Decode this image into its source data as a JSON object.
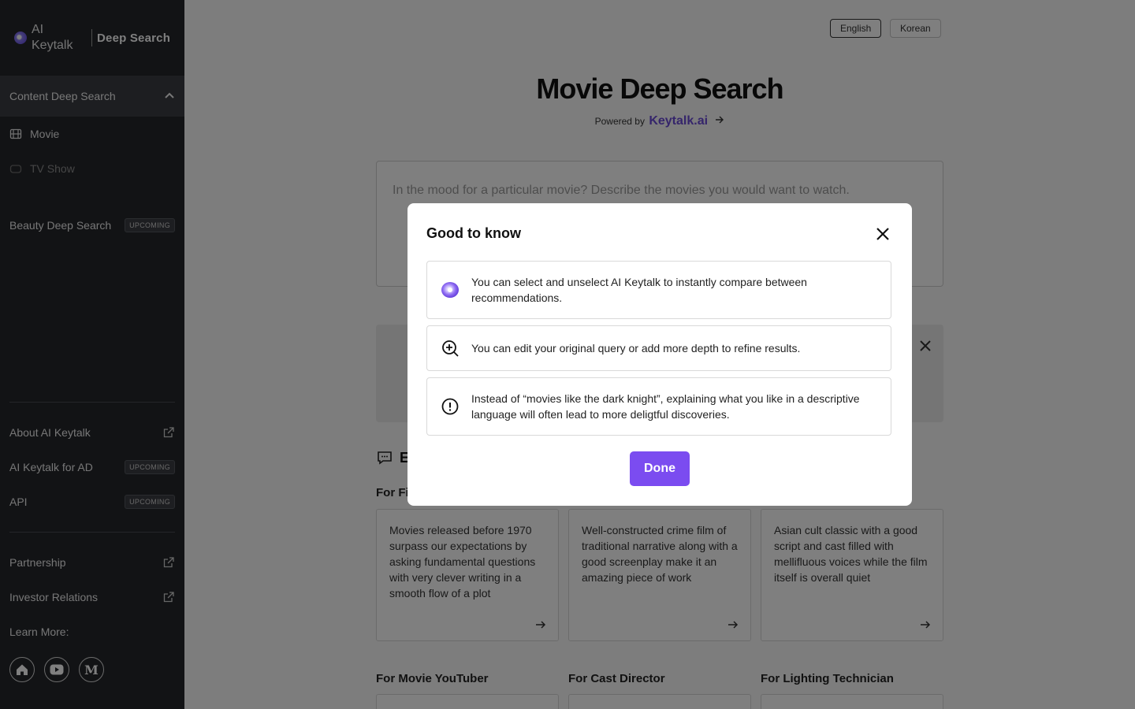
{
  "sidebar": {
    "brand_name": "AI Keytalk",
    "product": "Deep Search",
    "section_title": "Content Deep Search",
    "items": [
      {
        "label": "Movie"
      },
      {
        "label": "TV Show"
      }
    ],
    "beauty": {
      "label": "Beauty Deep Search",
      "badge": "UPCOMING"
    },
    "links": [
      {
        "label": "About AI Keytalk"
      },
      {
        "label": "AI Keytalk for AD",
        "badge": "UPCOMING"
      },
      {
        "label": "API",
        "badge": "UPCOMING"
      }
    ],
    "partnership": "Partnership",
    "investor": "Investor Relations",
    "learn_more": "Learn More:",
    "social": [
      "home-icon",
      "youtube-icon",
      "medium-icon"
    ],
    "medium_glyph": "M"
  },
  "header": {
    "lang_en": "English",
    "lang_ko": "Korean",
    "title": "Movie Deep Search",
    "powered_by": "Powered by",
    "powered_brand": "Keytalk.ai"
  },
  "query": {
    "placeholder": "In the mood for a particular movie? Describe the movies you would want to watch."
  },
  "examples": {
    "heading_visible": "E",
    "first_label": "For Fi",
    "cards": [
      "Movies released before 1970 surpass our expectations by asking fundamental questions with very clever writing in a smooth flow of a plot",
      "Well-constructed crime film of traditional narrative along with a good screenplay make it an amazing piece of work",
      "Asian cult classic with a good script and cast filled with mellifluous voices while the film itself is overall quiet"
    ],
    "second_row_labels": [
      "For Movie YouTuber",
      "For Cast Director",
      "For Lighting Technician"
    ]
  },
  "modal": {
    "title": "Good to know",
    "tips": [
      {
        "icon": "keytalk-orb-icon",
        "text": "You can select and unselect AI Keytalk to instantly compare between recommendations."
      },
      {
        "icon": "zoom-plus-icon",
        "text": "You can edit your original query or add more depth to refine results."
      },
      {
        "icon": "alert-circle-icon",
        "text": "Instead of “movies like the dark knight”, explaining what you like in a descriptive language will often lead to more deligtful discoveries."
      }
    ],
    "done_label": "Done"
  },
  "colors": {
    "accent": "#7b4cf0",
    "sidebar_bg": "#24262b",
    "brand_purple": "#6b4bd6"
  }
}
